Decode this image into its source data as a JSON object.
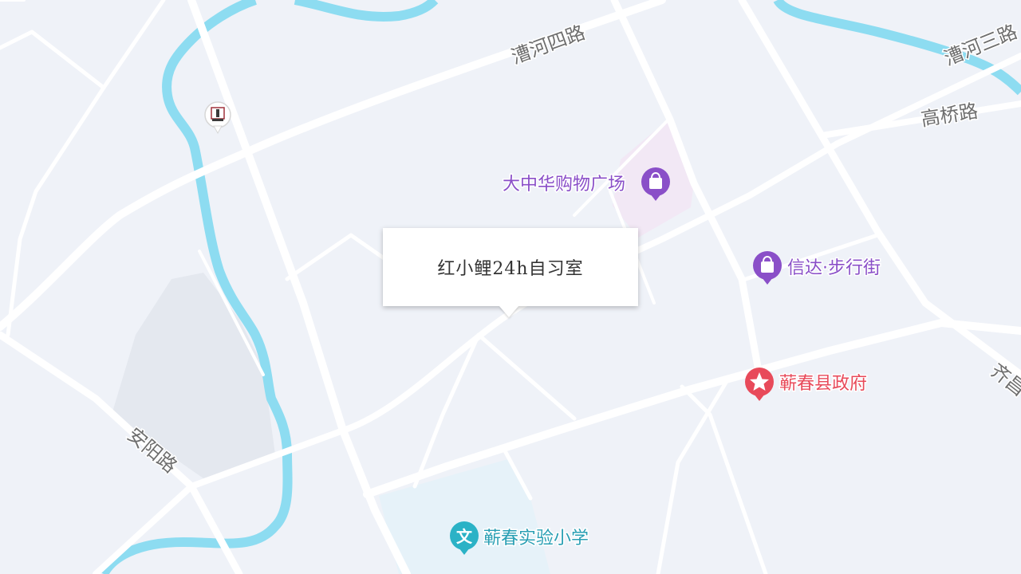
{
  "map": {
    "background": "#eff2f8",
    "road_color": "#ffffff",
    "river_color": "#8ddcf1"
  },
  "road_labels": {
    "caohe4": "漕河四路",
    "caohe3": "漕河三路",
    "gaoqiao": "高桥路",
    "anyang": "安阳路",
    "qichang": "齐昌"
  },
  "pois": {
    "dazhonghua": {
      "label": "大中华购物广场",
      "color": "#8a4fc8",
      "icon": "shopping-bag-icon"
    },
    "xinda": {
      "label": "信达·步行街",
      "color": "#8a4fc8",
      "icon": "shopping-bag-icon"
    },
    "government": {
      "label": "蕲春县政府",
      "color": "#e84a5a",
      "icon": "star-icon"
    },
    "school": {
      "label": "蕲春实验小学",
      "color": "#2bb2c6",
      "icon": "wen-icon",
      "icon_text": "文"
    },
    "landmark": {
      "icon": "landmark-icon"
    }
  },
  "popup": {
    "title": "红小鲤24h自习室"
  }
}
